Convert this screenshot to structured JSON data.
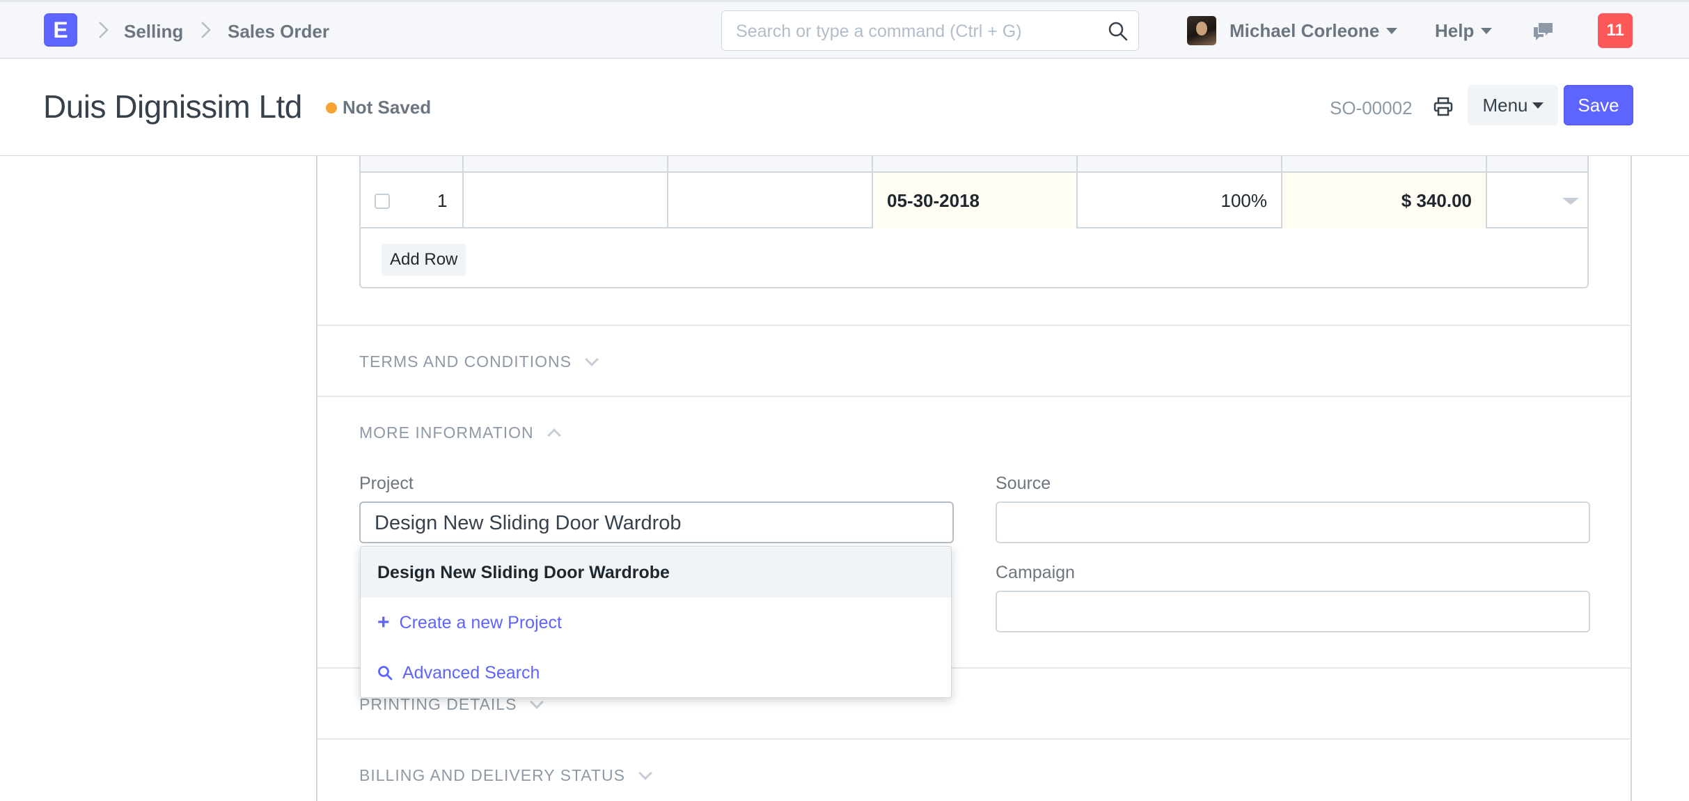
{
  "navbar": {
    "logo_letter": "E",
    "breadcrumbs": [
      "Selling",
      "Sales Order"
    ],
    "search_placeholder": "Search or type a command (Ctrl + G)",
    "user_name": "Michael Corleone",
    "help_label": "Help",
    "notification_count": "11"
  },
  "page_head": {
    "title": "Duis Dignissim Ltd",
    "status": "Not Saved",
    "doc_name": "SO-00002",
    "menu_label": "Menu",
    "save_label": "Save"
  },
  "items_table": {
    "rows": [
      {
        "idx": "1",
        "item_code": "",
        "description": "",
        "delivery_date": "05-30-2018",
        "percent": "100%",
        "amount": "$ 340.00"
      }
    ],
    "add_row_label": "Add Row"
  },
  "sections": {
    "terms": "TERMS AND CONDITIONS",
    "more_info": "MORE INFORMATION",
    "printing": "PRINTING DETAILS",
    "billing": "BILLING AND DELIVERY STATUS"
  },
  "more_info": {
    "project_label": "Project",
    "project_value": "Design New Sliding Door Wardrob",
    "source_label": "Source",
    "source_value": "",
    "campaign_label": "Campaign",
    "campaign_value": ""
  },
  "dropdown": {
    "suggestion": "Design New Sliding Door Wardrobe",
    "create_new": "Create a new Project",
    "advanced_search": "Advanced Search"
  },
  "colors": {
    "primary": "#5e64ff",
    "status_dot": "#f8a234",
    "notification": "#ff5858"
  }
}
